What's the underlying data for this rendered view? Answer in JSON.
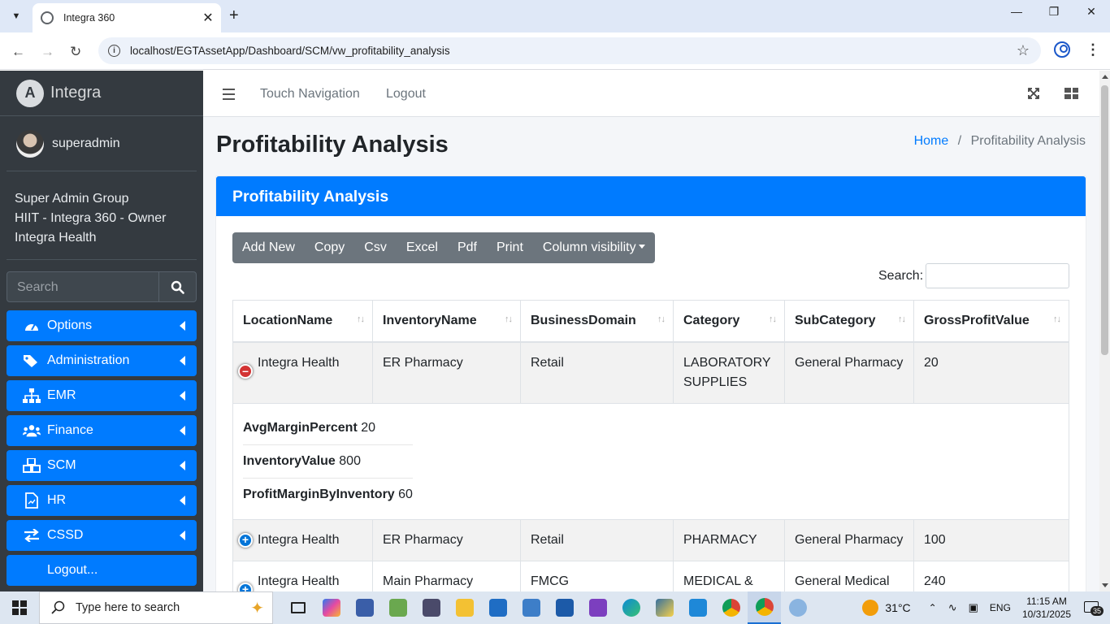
{
  "browser": {
    "tab_title": "Integra 360",
    "url": "localhost/EGTAssetApp/Dashboard/SCM/vw_profitability_analysis"
  },
  "sidebar": {
    "brand": "Integra",
    "user": "superadmin",
    "groups": [
      "Super Admin Group",
      "HIIT - Integra 360 - Owner",
      "Integra Health"
    ],
    "search_placeholder": "Search",
    "menu": [
      {
        "label": "Options",
        "icon": "tachometer-icon"
      },
      {
        "label": "Administration",
        "icon": "tags-icon"
      },
      {
        "label": "EMR",
        "icon": "sitemap-icon"
      },
      {
        "label": "Finance",
        "icon": "users-icon"
      },
      {
        "label": "SCM",
        "icon": "cubes-icon"
      },
      {
        "label": "HR",
        "icon": "file-icon"
      },
      {
        "label": "CSSD",
        "icon": "exchange-icon"
      },
      {
        "label": "Logout...",
        "icon": ""
      }
    ]
  },
  "topnav": {
    "touch": "Touch Navigation",
    "logout": "Logout"
  },
  "page": {
    "title": "Profitability Analysis",
    "breadcrumb_home": "Home",
    "breadcrumb_sep": "/",
    "breadcrumb_current": "Profitability Analysis"
  },
  "card": {
    "title": "Profitability Analysis",
    "buttons": [
      "Add New",
      "Copy",
      "Csv",
      "Excel",
      "Pdf",
      "Print",
      "Column visibility"
    ],
    "search_label": "Search:"
  },
  "table": {
    "columns": [
      "LocationName",
      "InventoryName",
      "BusinessDomain",
      "Category",
      "SubCategory",
      "GrossProfitValue"
    ],
    "rows": [
      [
        "Integra Health",
        "ER Pharmacy",
        "Retail",
        "LABORATORY SUPPLIES",
        "General Pharmacy",
        "20"
      ],
      [
        "Integra Health",
        "ER Pharmacy",
        "Retail",
        "PHARMACY",
        "General Pharmacy",
        "100"
      ],
      [
        "Integra Health",
        "Main Pharmacy",
        "FMCG",
        "MEDICAL & SURGICAL",
        "General Medical Supplies",
        "240"
      ]
    ],
    "child": [
      {
        "label": "AvgMarginPercent",
        "value": "20"
      },
      {
        "label": "InventoryValue",
        "value": "800"
      },
      {
        "label": "ProfitMarginByInventory",
        "value": "60"
      }
    ]
  },
  "taskbar": {
    "search_placeholder": "Type here to search",
    "temperature": "31°C",
    "language": "ENG",
    "time": "11:15 AM",
    "date": "10/31/2025",
    "notifications": "35"
  }
}
